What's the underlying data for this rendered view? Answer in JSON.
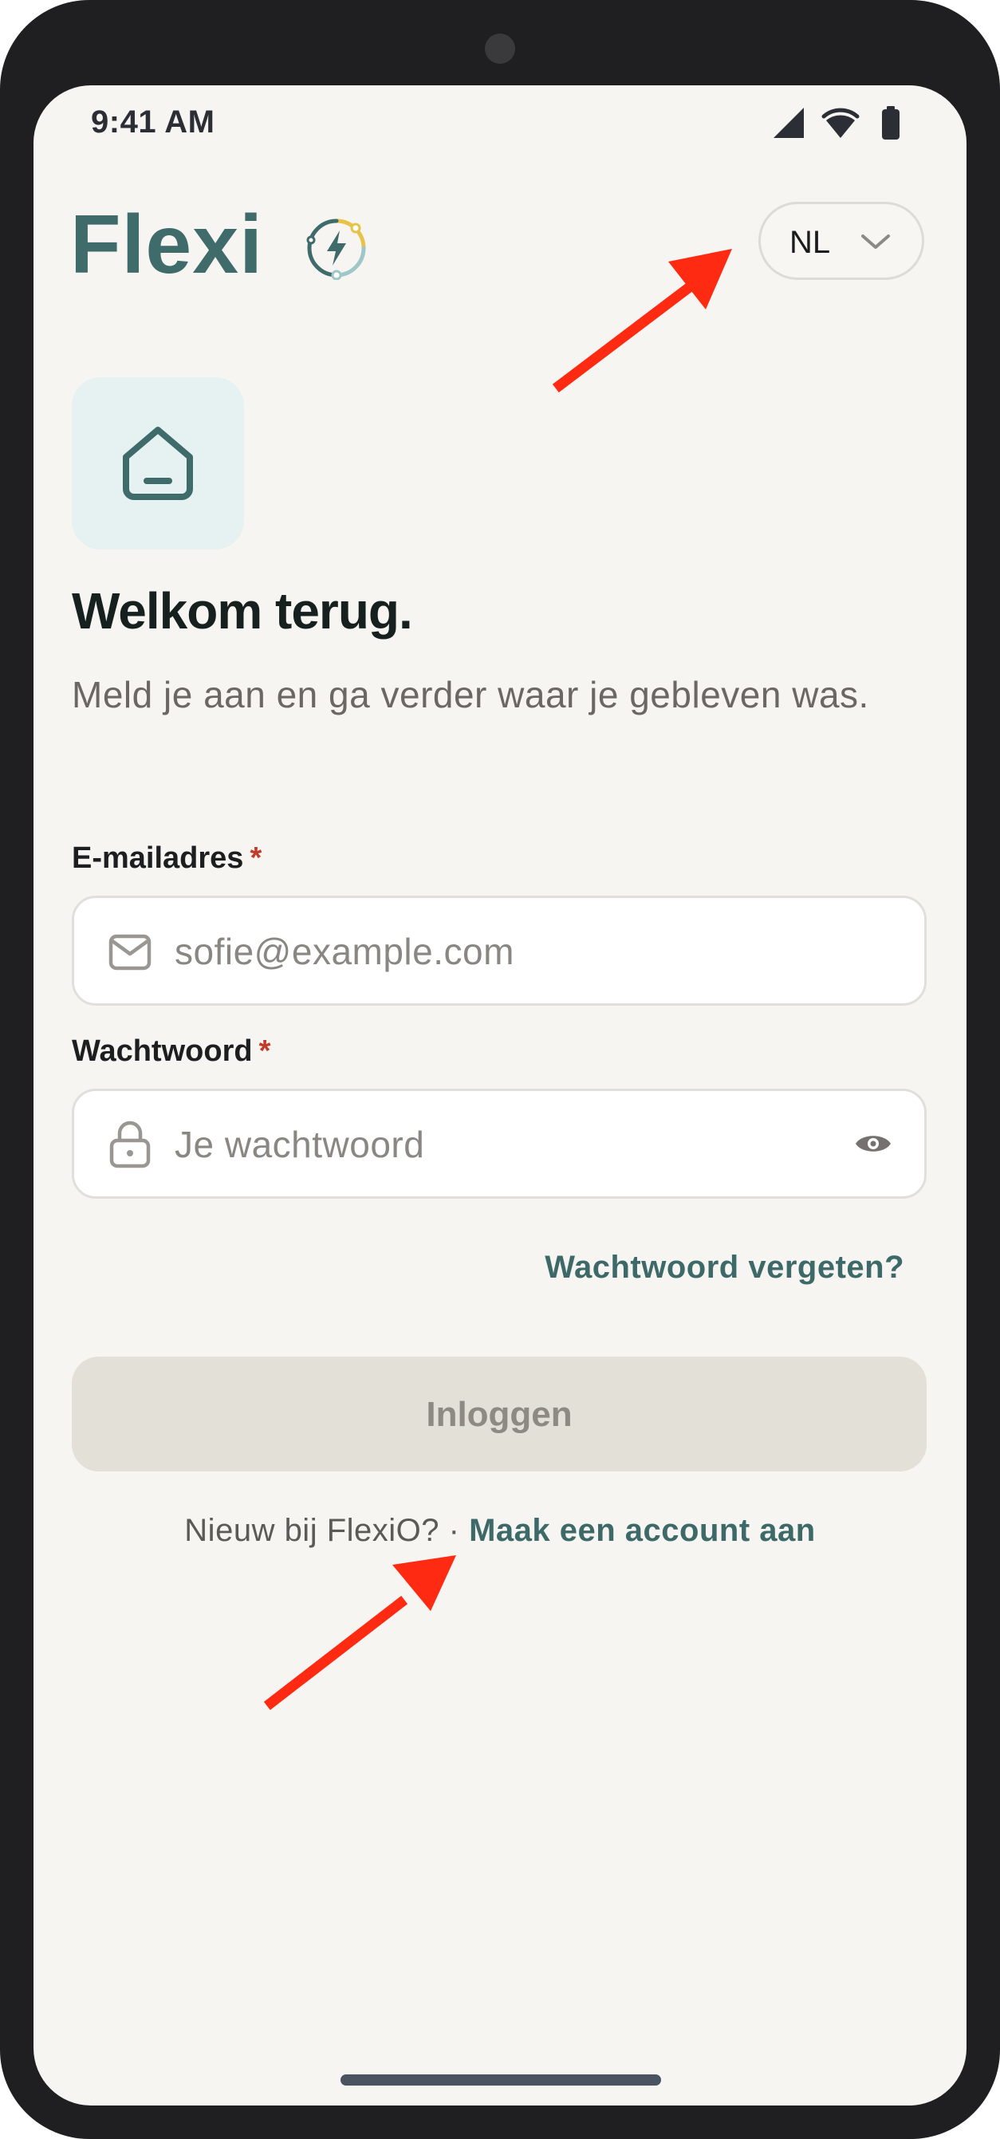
{
  "status_bar": {
    "time": "9:41 AM",
    "icons": [
      "cellular-icon",
      "wifi-icon",
      "battery-icon"
    ]
  },
  "header": {
    "logo_text": "Flexi",
    "logo_mark": "bolt-circle-icon",
    "language": {
      "selected": "NL",
      "chevron": "chevron-down-icon"
    }
  },
  "hero": {
    "icon": "home-icon",
    "title": "Welkom terug.",
    "subtitle": "Meld je aan en ga verder waar je gebleven was."
  },
  "form": {
    "email": {
      "label": "E-mailadres",
      "required_mark": "*",
      "value": "",
      "placeholder": "sofie@example.com",
      "icon": "mail-icon"
    },
    "password": {
      "label": "Wachtwoord",
      "required_mark": "*",
      "value": "",
      "placeholder": "Je wachtwoord",
      "icon": "lock-icon",
      "toggle_icon": "eye-icon"
    },
    "forgot_link": "Wachtwoord vergeten?",
    "submit_label": "Inloggen",
    "submit_enabled": false
  },
  "footer": {
    "prompt": "Nieuw bij FlexiO? ·",
    "signup_link": "Maak een account aan"
  },
  "colors": {
    "brand": "#3f6b6b",
    "accent_yellow": "#e8c34a",
    "background": "#f6f5f2",
    "required": "#c23a2a",
    "annotation_arrow": "#ff2a12",
    "disabled_button": "#e3e0d8"
  }
}
